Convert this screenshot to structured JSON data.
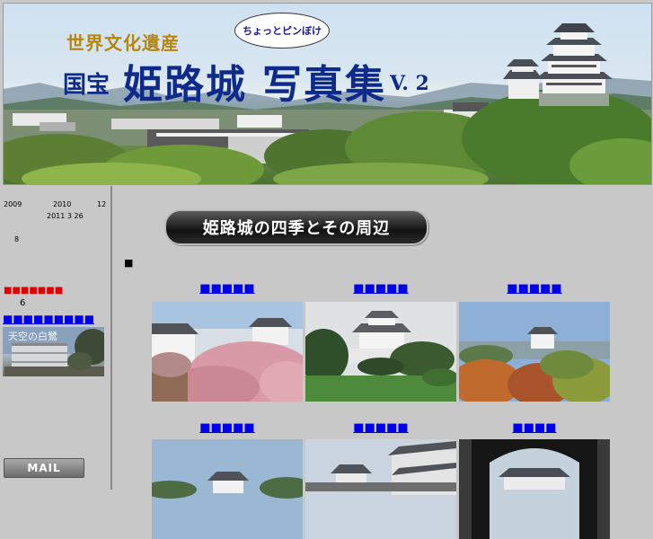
{
  "banner": {
    "subtitle": "世界文化遺産",
    "kokuho": "国宝",
    "main_title": "姫路城",
    "album": "写真集",
    "version": "V. 2",
    "bubble": "ちょっとピンぼけ"
  },
  "sidebar": {
    "date_line1": [
      "2009",
      "2010",
      "12"
    ],
    "date_line2": "2011 3 26",
    "count_small": "8",
    "notice": "■■■■■■■",
    "notice_count": "6",
    "link_label": "■■■■■■■■■",
    "thumb_caption": "天空の白鷺",
    "mail_label": "MAIL"
  },
  "main": {
    "section_title": "姫路城の四季とその周辺",
    "bullet": "■",
    "gallery": [
      {
        "label": "■■■■■"
      },
      {
        "label": "■■■■■"
      },
      {
        "label": "■■■■■"
      },
      {
        "label": "■■■■■"
      },
      {
        "label": "■■■■■"
      },
      {
        "label": "■■■■"
      }
    ]
  },
  "colors": {
    "link": "#0000ee",
    "notice": "#e00000",
    "title_blue": "#0e2a8a",
    "background": "#c8c8c8"
  }
}
